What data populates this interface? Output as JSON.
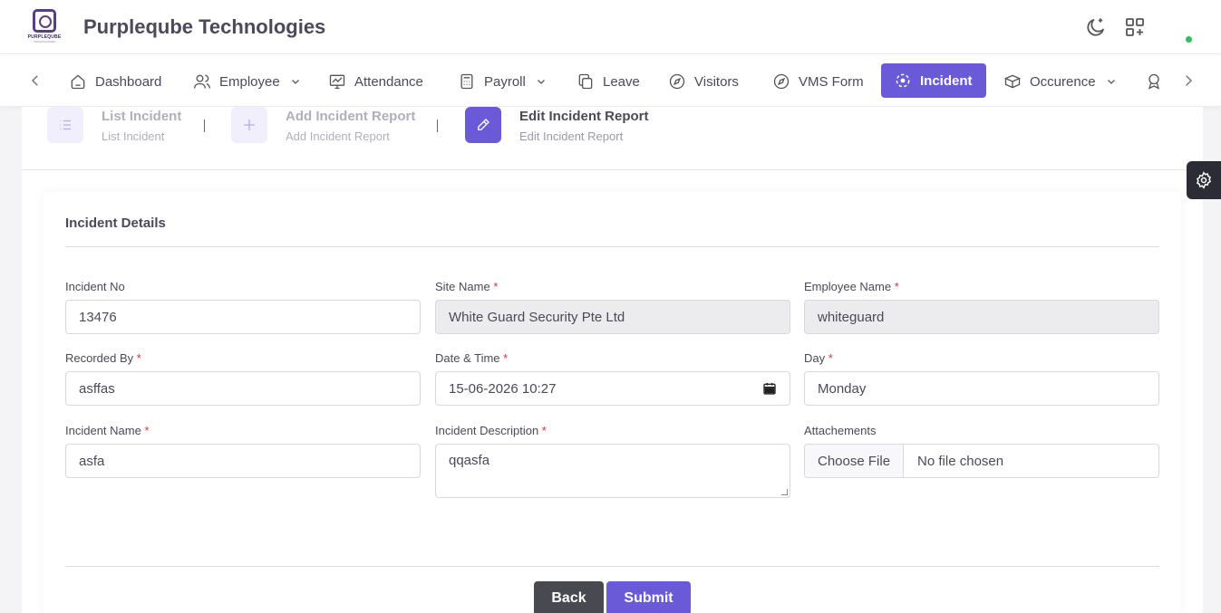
{
  "header": {
    "logo_text": "PURPLEQUBE",
    "logo_sub": "TECHNOLOGIES",
    "company": "Purpleqube Technologies"
  },
  "nav": {
    "items": [
      {
        "label": "Dashboard",
        "icon": "home-icon"
      },
      {
        "label": "Employee",
        "icon": "users-icon",
        "dropdown": true
      },
      {
        "label": "Attendance",
        "icon": "chart-icon"
      },
      {
        "label": "Payroll",
        "icon": "calculator-icon",
        "dropdown": true
      },
      {
        "label": "Leave",
        "icon": "copy-icon"
      },
      {
        "label": "Visitors",
        "icon": "compass-icon"
      },
      {
        "label": "VMS Form",
        "icon": "compass-icon"
      },
      {
        "label": "Incident",
        "icon": "incident-icon",
        "active": true
      },
      {
        "label": "Occurence",
        "icon": "box-icon",
        "dropdown": true
      }
    ]
  },
  "steps": [
    {
      "title": "List Incident",
      "subtitle": "List Incident"
    },
    {
      "title": "Add Incident Report",
      "subtitle": "Add Incident Report"
    },
    {
      "title": "Edit Incident Report",
      "subtitle": "Edit Incident Report",
      "active": true
    }
  ],
  "separator": "|",
  "form": {
    "title": "Incident Details",
    "fields": {
      "incident_no": {
        "label": "Incident No",
        "value": "13476"
      },
      "site_name": {
        "label": "Site Name",
        "value": "White Guard Security Pte Ltd"
      },
      "employee_name": {
        "label": "Employee Name",
        "value": "whiteguard"
      },
      "recorded_by": {
        "label": "Recorded By",
        "value": "asffas"
      },
      "date_time": {
        "label": "Date & Time",
        "value": "15-06-2026 10:27"
      },
      "day": {
        "label": "Day",
        "value": "Monday"
      },
      "incident_name": {
        "label": "Incident Name",
        "value": "asfa"
      },
      "incident_description": {
        "label": "Incident Description",
        "value": "qqasfa"
      },
      "attachments": {
        "label": "Attachements",
        "button": "Choose File",
        "status": "No file chosen"
      }
    },
    "required_mark": "*",
    "back_label": "Back",
    "submit_label": "Submit"
  },
  "colors": {
    "accent": "#6a5ad8",
    "required": "#d9303a",
    "status_online": "#2ec05a"
  }
}
